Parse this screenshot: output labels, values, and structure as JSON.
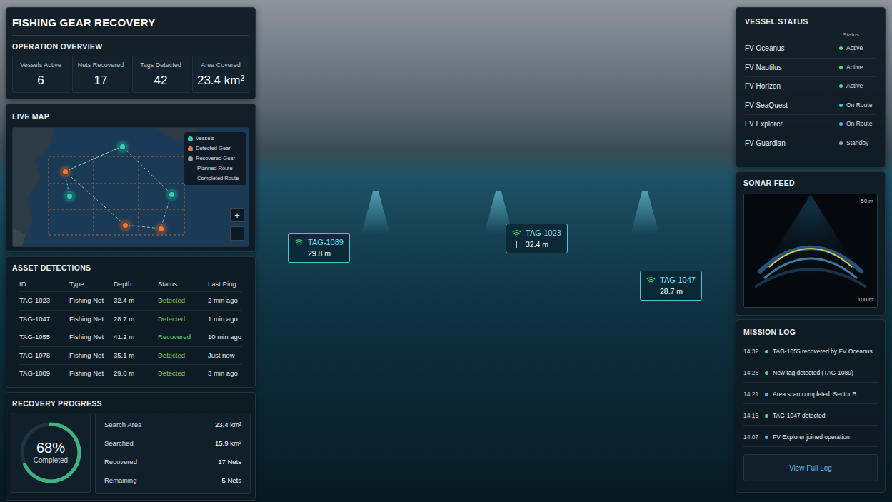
{
  "title": "FISHING GEAR RECOVERY",
  "overview": {
    "title": "OPERATION OVERVIEW",
    "stats": [
      {
        "label": "Vessels Active",
        "value": "6"
      },
      {
        "label": "Nets Recovered",
        "value": "17"
      },
      {
        "label": "Tags Detected",
        "value": "42"
      },
      {
        "label": "Area Covered",
        "value": "23.4 km²"
      }
    ]
  },
  "map": {
    "title": "LIVE MAP",
    "legend": [
      {
        "label": "Vessels",
        "kind": "dot",
        "color": "#2dd4bf"
      },
      {
        "label": "Detected Gear",
        "kind": "dot",
        "color": "#f07a3a"
      },
      {
        "label": "Recovered Gear",
        "kind": "dot",
        "color": "#a3a3a3"
      },
      {
        "label": "Planned Route",
        "kind": "dashed",
        "color": "#e5e7eb"
      },
      {
        "label": "Completed Route",
        "kind": "dashed",
        "color": "#5eead4"
      }
    ],
    "zoom": [
      "+",
      "−"
    ],
    "pins": [
      {
        "kind": "vessel"
      },
      {
        "kind": "vessel"
      },
      {
        "kind": "vessel"
      },
      {
        "kind": "detected"
      },
      {
        "kind": "detected"
      },
      {
        "kind": "detected"
      }
    ]
  },
  "assets": {
    "title": "ASSET DETECTIONS",
    "columns": [
      "ID",
      "Type",
      "Depth",
      "Status",
      "Last Ping"
    ],
    "rows": [
      {
        "id": "TAG-1023",
        "type": "Fishing Net",
        "depth": "32.4 m",
        "status": "Detected",
        "last_ping": "2 min ago",
        "color": "#7cc95a"
      },
      {
        "id": "TAG-1047",
        "type": "Fishing Net",
        "depth": "28.7 m",
        "status": "Detected",
        "last_ping": "1 min ago",
        "color": "#7cc95a"
      },
      {
        "id": "TAG-1055",
        "type": "Fishing Net",
        "depth": "41.2 m",
        "status": "Recovered",
        "last_ping": "10 min ago",
        "color": "#4ade80"
      },
      {
        "id": "TAG-1078",
        "type": "Fishing Net",
        "depth": "35.1 m",
        "status": "Detected",
        "last_ping": "Just now",
        "color": "#7cc95a"
      },
      {
        "id": "TAG-1089",
        "type": "Fishing Net",
        "depth": "29.8 m",
        "status": "Detected",
        "last_ping": "3 min ago",
        "color": "#7cc95a"
      }
    ]
  },
  "progress": {
    "title": "RECOVERY PROGRESS",
    "percent": "68%",
    "label": "Completed",
    "level": 0.68,
    "stats": [
      {
        "label": "Search Area",
        "value": "23.4 km²"
      },
      {
        "label": "Searched",
        "value": "15.9 km²"
      },
      {
        "label": "Recovered",
        "value": "17 Nets"
      },
      {
        "label": "Remaining",
        "value": "5 Nets"
      }
    ]
  },
  "vessels": {
    "title": "VESSEL STATUS",
    "column": "Status",
    "items": [
      {
        "name": "FV Oceanus",
        "status": "Active",
        "color": "#4ade80"
      },
      {
        "name": "FV Nautilus",
        "status": "Active",
        "color": "#4ade80"
      },
      {
        "name": "FV Horizon",
        "status": "Active",
        "color": "#4ade80"
      },
      {
        "name": "FV SeaQuest",
        "status": "On Route",
        "color": "#38bdf8"
      },
      {
        "name": "FV Explorer",
        "status": "On Route",
        "color": "#38bdf8"
      },
      {
        "name": "FV Guardian",
        "status": "Standby",
        "color": "#9ca3af"
      }
    ]
  },
  "sonar": {
    "title": "SONAR FEED",
    "top": "50 m",
    "bottom": "100 m"
  },
  "log": {
    "title": "MISSION LOG",
    "entries": [
      {
        "time": "14:32",
        "text": "TAG-1055 recovered by FV Oceanus",
        "color": "#4ade80"
      },
      {
        "time": "14:28",
        "text": "New tag detected (TAG-1089)",
        "color": "#4ade80"
      },
      {
        "time": "14:21",
        "text": "Area scan completed: Sector B",
        "color": "#38bdf8"
      },
      {
        "time": "14:15",
        "text": "TAG-1047 detected",
        "color": "#4ade80"
      },
      {
        "time": "14:07",
        "text": "FV Explorer joined operation",
        "color": "#38bdf8"
      }
    ],
    "button": "View Full Log"
  },
  "tags": [
    {
      "id": "TAG-1089",
      "depth": "29.8 m"
    },
    {
      "id": "TAG-1023",
      "depth": "32.4 m"
    },
    {
      "id": "TAG-1047",
      "depth": "28.7 m"
    }
  ]
}
